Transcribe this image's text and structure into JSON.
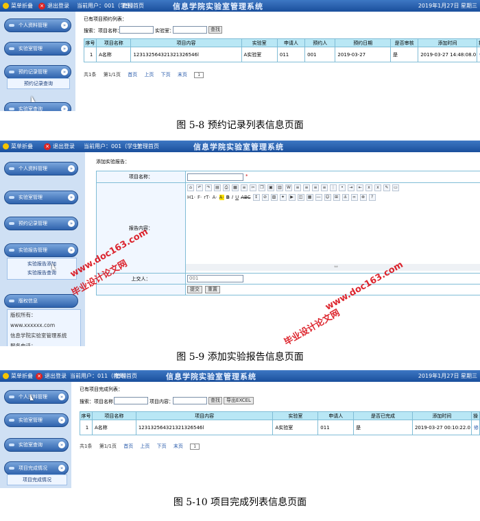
{
  "colors": {
    "topbar": "#1a4f9c",
    "sidebar": "#cfe0f4",
    "table_header": "#b9e7f5",
    "watermark": "#d8000a"
  },
  "topbar": {
    "menu": "菜单折叠",
    "logout": "退出登录",
    "user1": "当前用户：001（学生）",
    "user3": "当前用户：011（教师）",
    "home": "管理首页",
    "title": "信息学院实验室管理系统",
    "date": "2019年1月27日 星期三"
  },
  "sidebar": {
    "personal": "个人资料管理",
    "lab": "实验室管理",
    "booking": "预约记录管理",
    "booking_query": "预约记录查询",
    "report": "实验报告管理",
    "report_add": "实验报告添加",
    "report_query": "实验报告查询",
    "lab_query": "实验室查询",
    "completion": "项目完成情况",
    "completion_item": "项目完成情况",
    "copyright": {
      "title": "版权信息",
      "owner_label": "版权所有：",
      "site": "www.xxxxxx.com",
      "org": "信息学院实验室管理系统",
      "contact": "服务电话："
    }
  },
  "s1": {
    "heading": "已有项目预约列表：",
    "search_name": "搜索：项目名称：",
    "search_lab": "实验室：",
    "search_btn": "查找",
    "columns": [
      "序号",
      "项目名称",
      "项目内容",
      "实验室",
      "申请人",
      "预约人",
      "预约日期",
      "是否审核",
      "添加时间",
      "操"
    ],
    "rows": [
      [
        "1",
        "A名称",
        "123132564321321326546l",
        "A实验室",
        "011",
        "001",
        "2019-03-27",
        "是",
        "2019-03-27 14:48:08.0",
        "修"
      ]
    ],
    "pager": {
      "total": "共1条",
      "page": "第1/1页",
      "first": "首页",
      "prev": "上页",
      "next": "下页",
      "last": "末页",
      "sel": "1"
    },
    "caption": "图 5-8 预约记录列表信息页面"
  },
  "s2": {
    "heading": "添加实验报告：",
    "name_label": "项目名称：",
    "star": "*",
    "content_label": "报告内容：",
    "submitter_label": "上交人：",
    "submitter_value": "001",
    "submit": "提交",
    "reset": "重置",
    "toolbar_row2": [
      "H1·",
      "F·",
      "rT·",
      "A·",
      "A·",
      "B",
      "I",
      "U",
      "ABC"
    ],
    "caption": "图 5-9 添加实验报告信息页面"
  },
  "s3": {
    "heading": "已有项目完成列表：",
    "search_name": "搜索：项目名称：",
    "search_content": "项目内容：",
    "search_btn": "查找",
    "export_btn": "导出EXCEL",
    "columns": [
      "序号",
      "项目名称",
      "项目内容",
      "实验室",
      "申请人",
      "是否已完成",
      "添加时间",
      "操"
    ],
    "rows": [
      [
        "1",
        "A名称",
        "123132564321321326546l",
        "A实验室",
        "011",
        "是",
        "2019-03-27 00:10:22.0",
        "修"
      ]
    ],
    "pager": {
      "total": "共1条",
      "page": "第1/1页",
      "first": "首页",
      "prev": "上页",
      "next": "下页",
      "last": "末页",
      "sel": "1"
    },
    "caption": "图 5-10 项目完成列表信息页面"
  },
  "watermark": {
    "site": "www.doc163.com",
    "cn": "毕业设计论文网"
  }
}
